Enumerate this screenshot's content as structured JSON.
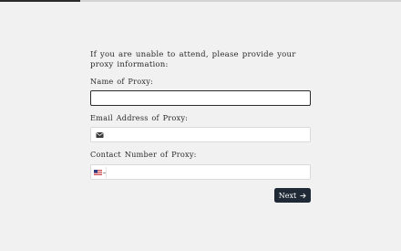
{
  "progress": {
    "fraction": 0.2,
    "fill_color": "#2b2b2b"
  },
  "question": {
    "text": "If you are unable to attend, please provide your proxy information:"
  },
  "fields": {
    "proxy_name": {
      "label": "Name of Proxy:",
      "value": "",
      "placeholder": ""
    },
    "proxy_email": {
      "label": "Email Address of Proxy:",
      "value": "",
      "placeholder": "",
      "icon": "envelope-icon"
    },
    "proxy_phone": {
      "label": "Contact Number of Proxy:",
      "value": "",
      "placeholder": "",
      "country_flag": "us-flag-icon"
    }
  },
  "next_button": {
    "label": "Next",
    "icon": "arrow-right-icon",
    "color": "#1f2a36"
  }
}
